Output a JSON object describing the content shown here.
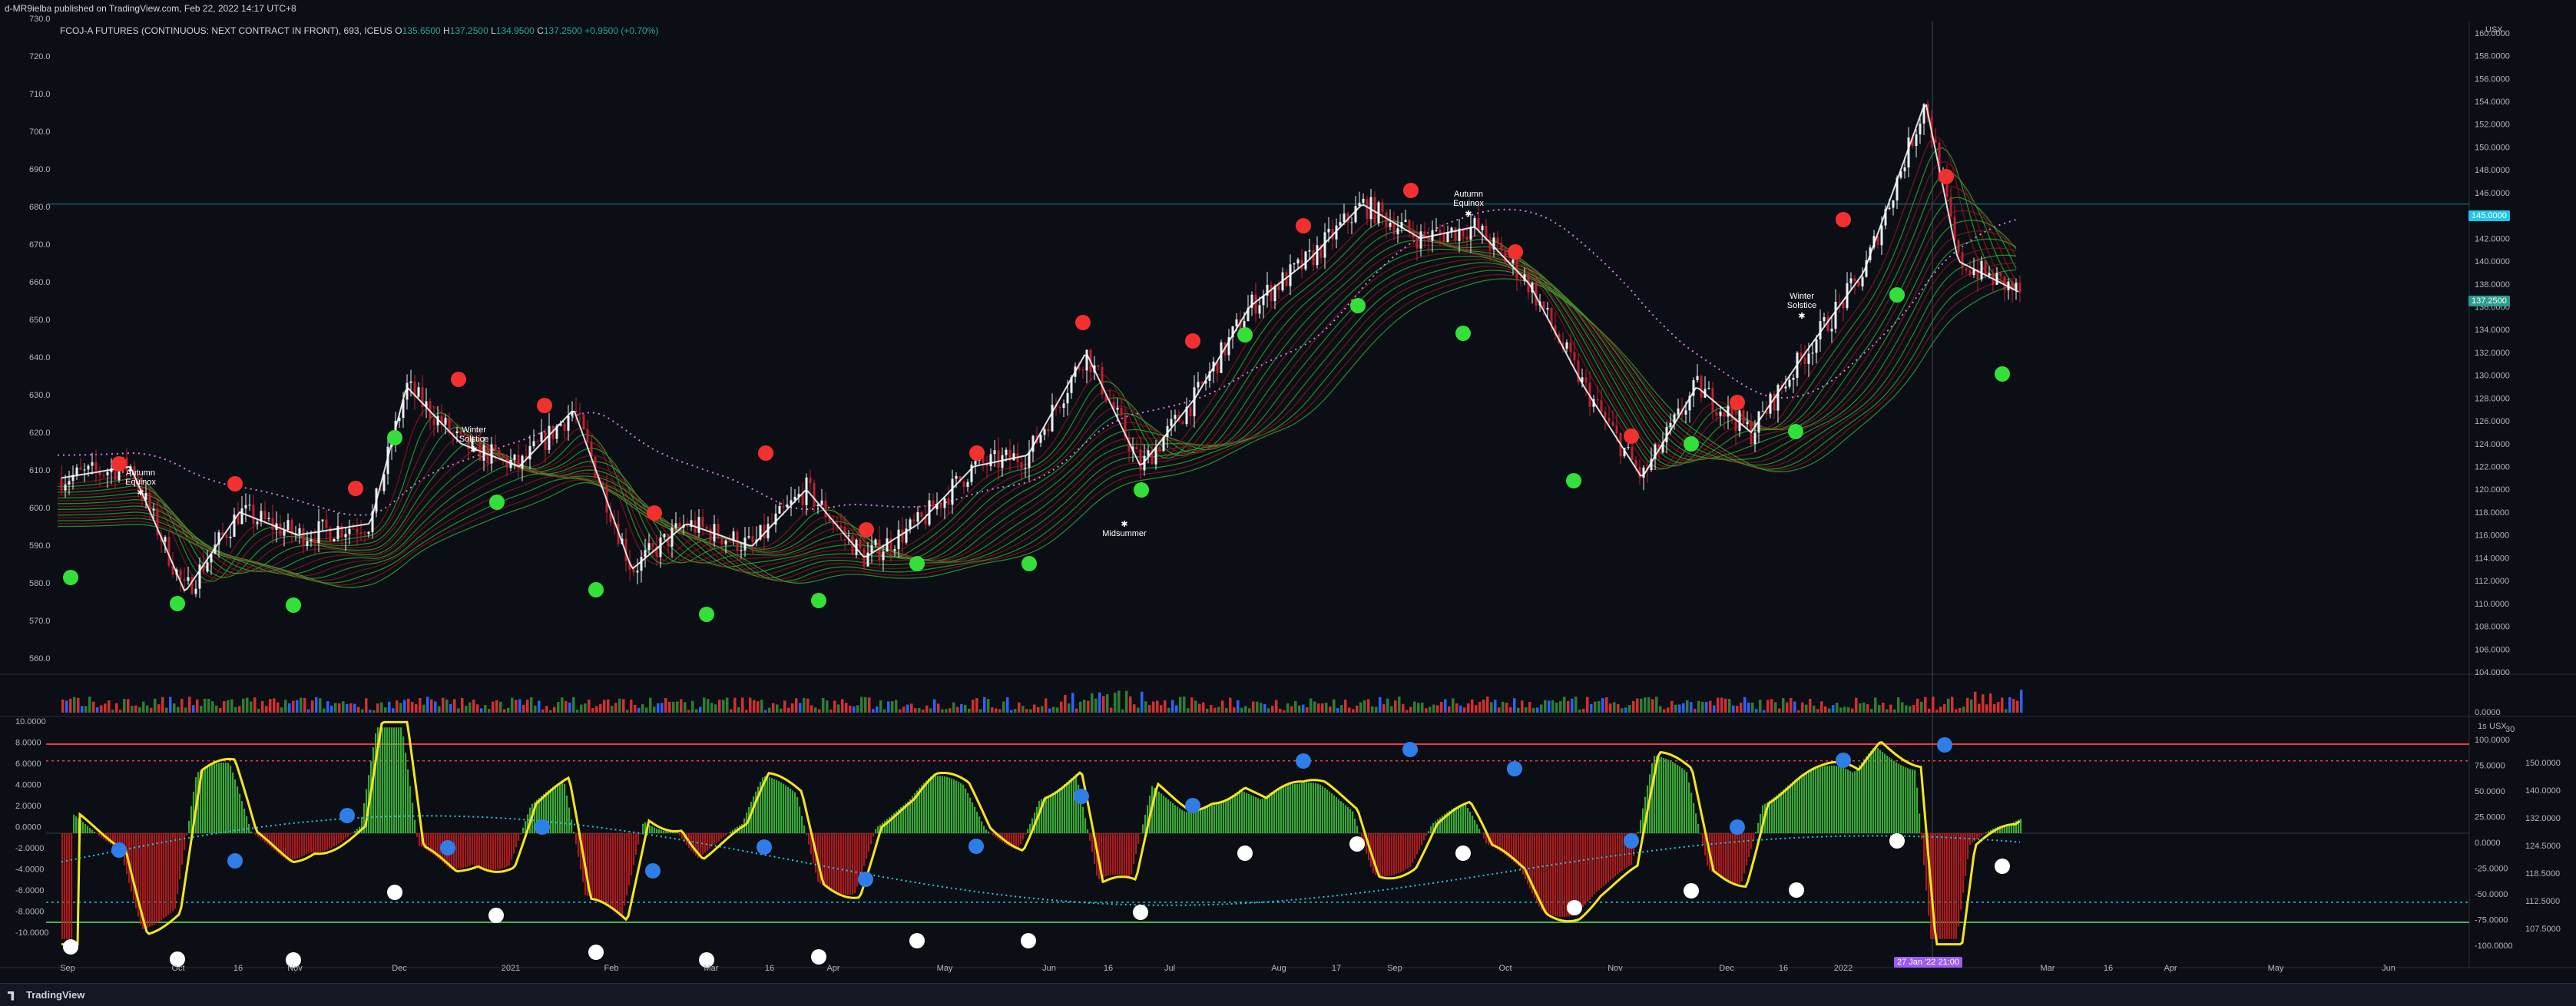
{
  "header": {
    "published": "d-MR9ielba published on TradingView.com, Feb 22, 2022 14:17 UTC+8",
    "symbol_line": "FCOJ-A FUTURES (CONTINUOUS: NEXT CONTRACT IN FRONT), 693, ICEUS",
    "o_label": "O",
    "o_value": "135.6500",
    "h_label": "H",
    "h_value": "137.2500",
    "l_label": "L",
    "l_value": "134.9500",
    "c_label": "C",
    "c_value": "137.2500",
    "change": "+0.9500 (+0.70%)"
  },
  "axes": {
    "left_price_ticks": [
      "730.0",
      "720.0",
      "710.0",
      "700.0",
      "690.0",
      "680.0",
      "670.0",
      "660.0",
      "650.0",
      "640.0",
      "630.0",
      "620.0",
      "610.0",
      "600.0",
      "590.0",
      "580.0",
      "570.0",
      "560.0"
    ],
    "right_price_ticks": [
      "160.0000",
      "158.0000",
      "156.0000",
      "154.0000",
      "152.0000",
      "150.0000",
      "148.0000",
      "146.0000",
      "144.0000",
      "142.0000",
      "140.0000",
      "138.0000",
      "136.0000",
      "134.0000",
      "132.0000",
      "130.0000",
      "128.0000",
      "126.0000",
      "124.0000",
      "122.0000",
      "120.0000",
      "118.0000",
      "116.0000",
      "114.0000",
      "112.0000",
      "110.0000",
      "108.0000",
      "106.0000",
      "104.0000"
    ],
    "volume_tick": "0.0000",
    "currency": "USX",
    "osc_left_ticks": [
      "10.0000",
      "8.0000",
      "6.0000",
      "4.0000",
      "2.0000",
      "0.0000",
      "-2.0000",
      "-4.0000",
      "-6.0000",
      "-8.0000",
      "-10.0000"
    ],
    "osc_right_ticks": [
      "100.0000",
      "75.0000",
      "50.0000",
      "25.0000",
      "0.0000",
      "-25.0000",
      "-50.0000",
      "-75.0000",
      "-100.0000"
    ],
    "osc_right2_ticks": [
      "150.0000",
      "140.0000",
      "132.0000",
      "124.5000",
      "118.5000",
      "112.5000",
      "107.5000"
    ],
    "osc_corner": "1s",
    "osc_corner2": "30",
    "time_ticks": [
      "Sep",
      "Oct",
      "16",
      "Nov",
      "Dec",
      "2021",
      "Feb",
      "Mar",
      "16",
      "Apr",
      "May",
      "Jun",
      "16",
      "Jul",
      "Aug",
      "17",
      "Sep",
      "Oct",
      "Nov",
      "Dec",
      "16",
      "2022",
      "Mar",
      "16",
      "Apr",
      "May",
      "Jun"
    ]
  },
  "price_tags": {
    "level": "145.0000",
    "last": "137.2500",
    "time_cursor": "27 Jan '22  21:00"
  },
  "annotations": [
    {
      "text": "Autumn",
      "text2": "Equinox"
    },
    {
      "text": "Winter",
      "text2": "Solstice"
    },
    {
      "text": "Midsummer",
      "text2": ""
    },
    {
      "text": "Autumn",
      "text2": "Equinox"
    },
    {
      "text": "Winter",
      "text2": "Solstice"
    }
  ],
  "footer": {
    "brand": "TradingView"
  },
  "colors": {
    "background": "#0c0e15",
    "up_candle": "#e8f1f2",
    "down_candle": "#c21f2b",
    "ribbon_bull": "#2fae35",
    "ribbon_bear": "#8b1a1a",
    "dot_red": "#f23030",
    "dot_green": "#33e03a",
    "dot_blue": "#2f7ee8",
    "osc_line": "#f5e51c",
    "level_tag": "#1ec8e6",
    "last_tag": "#2a9d8f",
    "cursor_tag": "#9c5cf0"
  },
  "chart_data": {
    "type": "candlestick",
    "title": "FCOJ-A FUTURES (CONTINUOUS: NEXT CONTRACT IN FRONT), 693, ICEUS",
    "x_range": [
      "2020-09",
      "2022-06"
    ],
    "ylim_right": [
      104,
      161
    ],
    "ylim_left": [
      555,
      731
    ],
    "close_path": {
      "dates": [
        "2020-09-01",
        "2020-09-20",
        "2020-10-05",
        "2020-10-20",
        "2020-11-05",
        "2020-11-25",
        "2020-12-05",
        "2020-12-20",
        "2021-01-05",
        "2021-01-20",
        "2021-02-05",
        "2021-02-20",
        "2021-03-10",
        "2021-03-25",
        "2021-04-10",
        "2021-04-25",
        "2021-05-10",
        "2021-05-25",
        "2021-06-10",
        "2021-06-25",
        "2021-07-10",
        "2021-07-25",
        "2021-08-10",
        "2021-08-25",
        "2021-09-10",
        "2021-09-25",
        "2021-10-10",
        "2021-10-25",
        "2021-11-10",
        "2021-11-25",
        "2021-12-10",
        "2021-12-25",
        "2022-01-10",
        "2022-01-27",
        "2022-02-05",
        "2022-02-22"
      ],
      "values": [
        121,
        122,
        111,
        118,
        116,
        117,
        129,
        124,
        122,
        127,
        113,
        117,
        115,
        120,
        114,
        117,
        122,
        123,
        132,
        122,
        128,
        136,
        140,
        145,
        142,
        143,
        138,
        129,
        121,
        129,
        125,
        132,
        139,
        154,
        140,
        137.25
      ]
    },
    "volume_note": "histogram of red/green/blue bars under price",
    "oscillator": {
      "histogram_range": [
        -10,
        10
      ],
      "line_range": [
        -100,
        100
      ],
      "upper_band": 8.0,
      "lower_band": -8.0
    }
  }
}
